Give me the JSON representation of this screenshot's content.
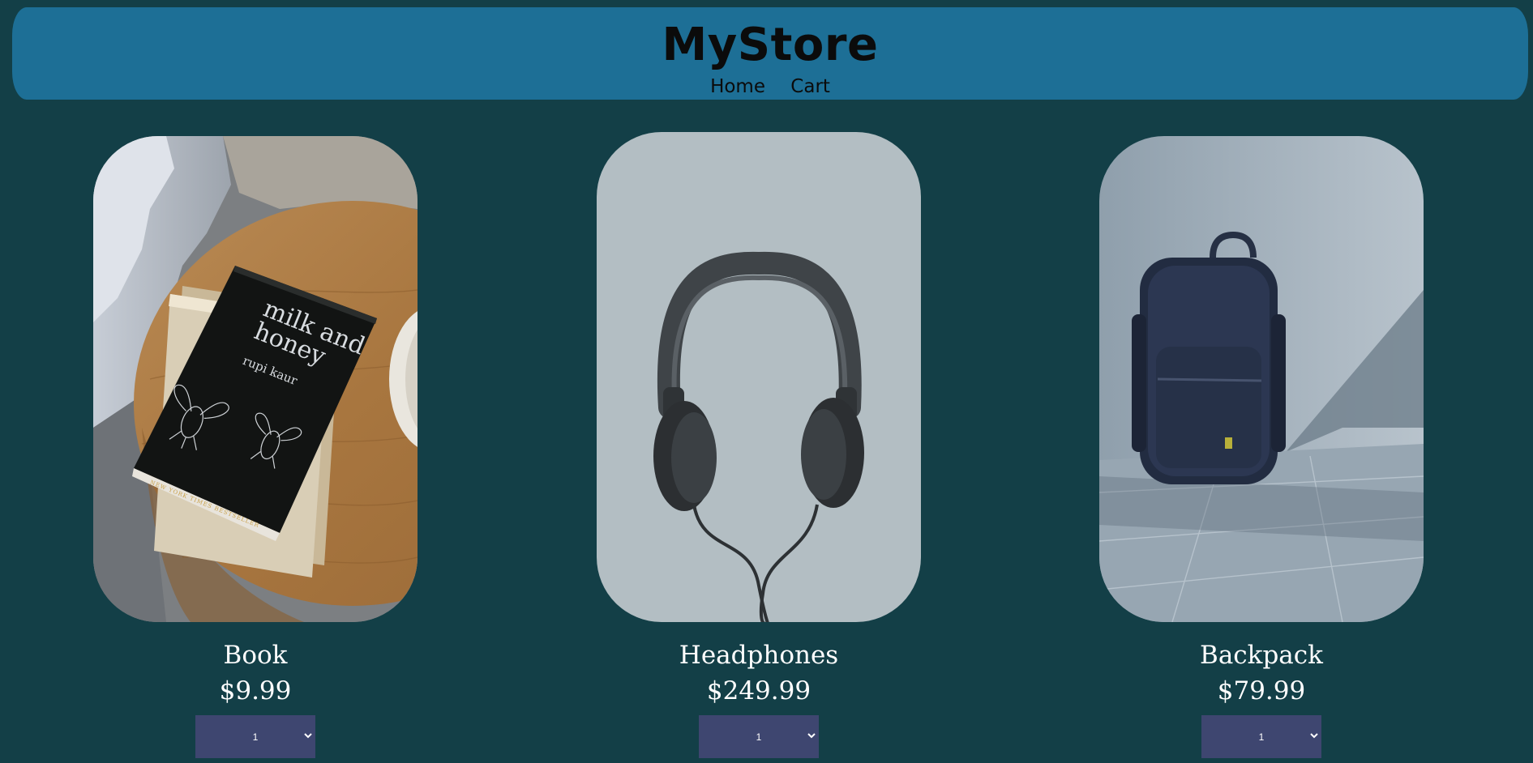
{
  "header": {
    "brand": "MyStore",
    "nav": [
      {
        "label": "Home"
      },
      {
        "label": "Cart"
      }
    ],
    "color": "#1d6f96"
  },
  "page": {
    "background": "#133f47"
  },
  "products": [
    {
      "name": "Book",
      "price": "$9.99",
      "image": "book-photo",
      "image_text": {
        "title": "milk and honey",
        "author": "rupi kaur",
        "banner": "NEW YORK TIMES BESTSELLER"
      },
      "quantity": "1",
      "quantity_options": [
        "1"
      ]
    },
    {
      "name": "Headphones",
      "price": "$249.99",
      "image": "headphones-photo",
      "quantity": "1",
      "quantity_options": [
        "1"
      ]
    },
    {
      "name": "Backpack",
      "price": "$79.99",
      "image": "backpack-photo",
      "quantity": "1",
      "quantity_options": [
        "1"
      ]
    }
  ],
  "colors": {
    "select_bg": "#3e4670",
    "text": "#ffffff"
  }
}
